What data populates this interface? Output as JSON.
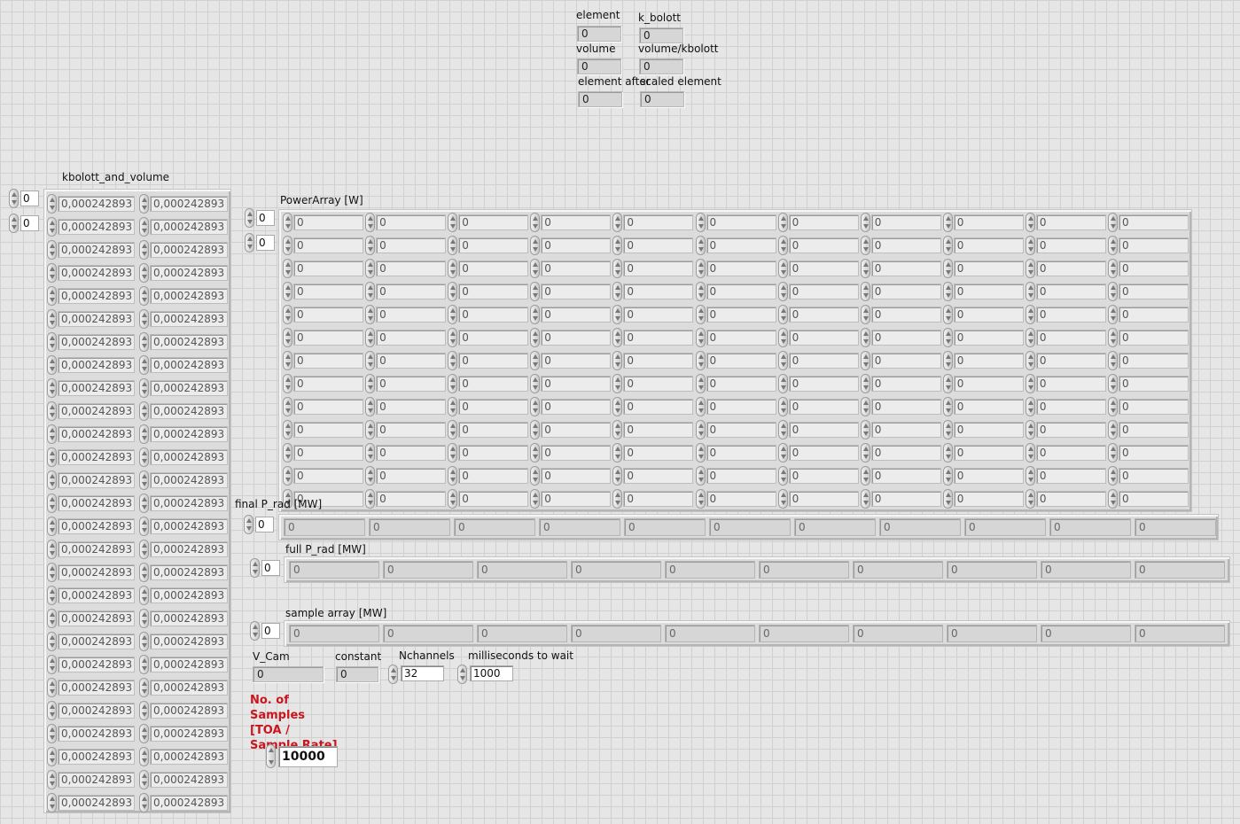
{
  "indicators": {
    "element": {
      "label": "element",
      "value": "0"
    },
    "k_bolott": {
      "label": "k_bolott",
      "value": "0"
    },
    "volume": {
      "label": "volume",
      "value": "0"
    },
    "volume_kbolott": {
      "label": "volume/kbolott",
      "value": "0"
    },
    "element_after": {
      "label": "element after",
      "value": "0"
    },
    "scaled_element": {
      "label": "scaled element",
      "value": "0"
    }
  },
  "kbolott_and_volume": {
    "label": "kbolott_and_volume",
    "index": [
      "0",
      "0"
    ],
    "col1": [
      "0,000242893",
      "0,000242893",
      "0,000242893",
      "0,000242893",
      "0,000242893",
      "0,000242893",
      "0,000242893",
      "0,000242893",
      "0,000242893",
      "0,000242893",
      "0,000242893",
      "0,000242893",
      "0,000242893",
      "0,000242893",
      "0,000242893",
      "0,000242893",
      "0,000242893",
      "0,000242893",
      "0,000242893",
      "0,000242893",
      "0,000242893",
      "0,000242893",
      "0,000242893",
      "0,000242893",
      "0,000242893",
      "0,000242893",
      "0,000242893"
    ],
    "col2": [
      "0,000242893",
      "0,000242893",
      "0,000242893",
      "0,000242893",
      "0,000242893",
      "0,000242893",
      "0,000242893",
      "0,000242893",
      "0,000242893",
      "0,000242893",
      "0,000242893",
      "0,000242893",
      "0,000242893",
      "0,000242893",
      "0,000242893",
      "0,000242893",
      "0,000242893",
      "0,000242893",
      "0,000242893",
      "0,000242893",
      "0,000242893",
      "0,000242893",
      "0,000242893",
      "0,000242893",
      "0,000242893",
      "0,000242893",
      "0,000242893"
    ]
  },
  "power_array": {
    "label": "PowerArray [W]",
    "index": [
      "0",
      "0"
    ],
    "rows": [
      [
        "0",
        "0",
        "0",
        "0",
        "0",
        "0",
        "0",
        "0",
        "0",
        "0",
        "0"
      ],
      [
        "0",
        "0",
        "0",
        "0",
        "0",
        "0",
        "0",
        "0",
        "0",
        "0",
        "0"
      ],
      [
        "0",
        "0",
        "0",
        "0",
        "0",
        "0",
        "0",
        "0",
        "0",
        "0",
        "0"
      ],
      [
        "0",
        "0",
        "0",
        "0",
        "0",
        "0",
        "0",
        "0",
        "0",
        "0",
        "0"
      ],
      [
        "0",
        "0",
        "0",
        "0",
        "0",
        "0",
        "0",
        "0",
        "0",
        "0",
        "0"
      ],
      [
        "0",
        "0",
        "0",
        "0",
        "0",
        "0",
        "0",
        "0",
        "0",
        "0",
        "0"
      ],
      [
        "0",
        "0",
        "0",
        "0",
        "0",
        "0",
        "0",
        "0",
        "0",
        "0",
        "0"
      ],
      [
        "0",
        "0",
        "0",
        "0",
        "0",
        "0",
        "0",
        "0",
        "0",
        "0",
        "0"
      ],
      [
        "0",
        "0",
        "0",
        "0",
        "0",
        "0",
        "0",
        "0",
        "0",
        "0",
        "0"
      ],
      [
        "0",
        "0",
        "0",
        "0",
        "0",
        "0",
        "0",
        "0",
        "0",
        "0",
        "0"
      ],
      [
        "0",
        "0",
        "0",
        "0",
        "0",
        "0",
        "0",
        "0",
        "0",
        "0",
        "0"
      ],
      [
        "0",
        "0",
        "0",
        "0",
        "0",
        "0",
        "0",
        "0",
        "0",
        "0",
        "0"
      ],
      [
        "0",
        "0",
        "0",
        "0",
        "0",
        "0",
        "0",
        "0",
        "0",
        "0",
        "0"
      ]
    ]
  },
  "final_p_rad": {
    "label": "final P_rad [MW]",
    "index": "0",
    "values": [
      "0",
      "0",
      "0",
      "0",
      "0",
      "0",
      "0",
      "0",
      "0",
      "0",
      "0"
    ]
  },
  "full_p_rad": {
    "label": "full P_rad [MW]",
    "index": "0",
    "values": [
      "0",
      "0",
      "0",
      "0",
      "0",
      "0",
      "0",
      "0",
      "0",
      "0"
    ]
  },
  "sample_array": {
    "label": "sample array [MW]",
    "index": "0",
    "values": [
      "0",
      "0",
      "0",
      "0",
      "0",
      "0",
      "0",
      "0",
      "0",
      "0"
    ]
  },
  "v_cam": {
    "label": "V_Cam",
    "value": "0"
  },
  "constant": {
    "label": "constant",
    "value": "0"
  },
  "nchannels": {
    "label": "Nchannels",
    "value": "32"
  },
  "ms_wait": {
    "label": "milliseconds to wait",
    "value": "1000"
  },
  "no_samples": {
    "label": "No. of Samples [TOA / Sample Rate]",
    "value": "10000"
  }
}
